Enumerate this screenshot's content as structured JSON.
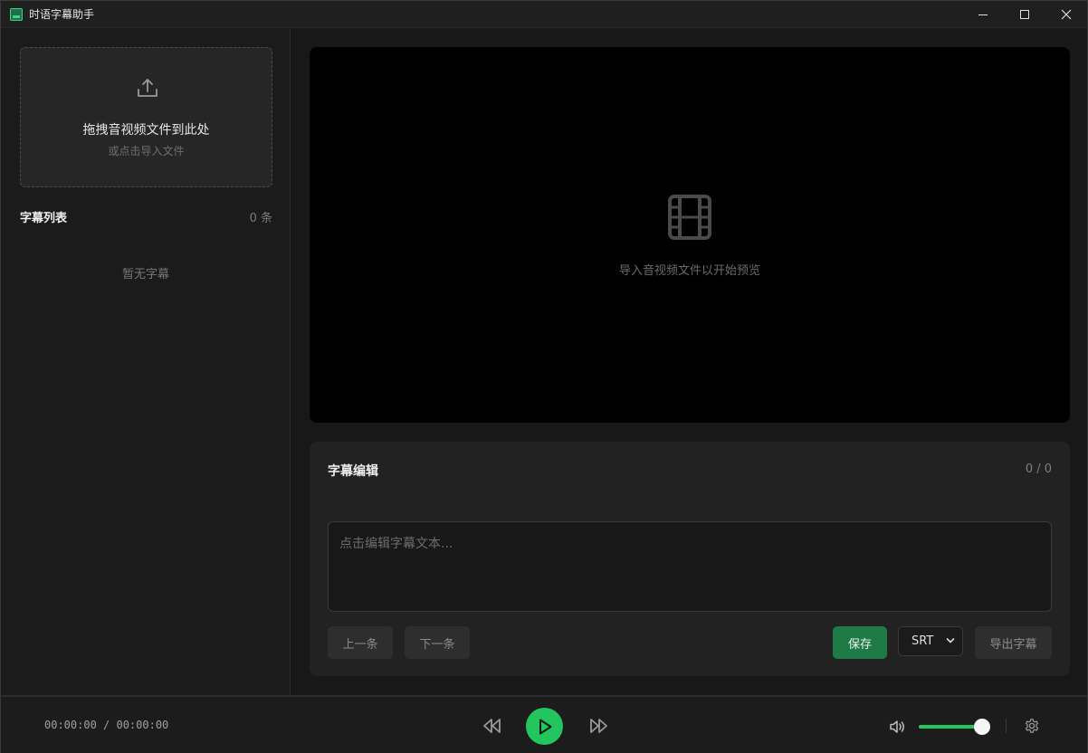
{
  "app": {
    "title": "时语字幕助手"
  },
  "sidebar": {
    "dropzone": {
      "title": "拖拽音视频文件到此处",
      "subtitle": "或点击导入文件"
    },
    "list": {
      "title": "字幕列表",
      "count": "0 条",
      "empty": "暂无字幕"
    }
  },
  "preview": {
    "hint": "导入音视频文件以开始预览"
  },
  "editor": {
    "title": "字幕编辑",
    "counter": "0 / 0",
    "placeholder": "点击编辑字幕文本...",
    "prev_label": "上一条",
    "next_label": "下一条",
    "save_label": "保存",
    "format_selected": "SRT",
    "export_label": "导出字幕"
  },
  "player": {
    "time": "00:00:00 / 00:00:00",
    "volume": 0.9
  },
  "colors": {
    "accent": "#22c55e",
    "save": "#1f7a45"
  },
  "icons": [
    "upload-icon",
    "film-icon",
    "rewind-icon",
    "play-icon",
    "fast-forward-icon",
    "volume-icon",
    "gear-icon"
  ]
}
